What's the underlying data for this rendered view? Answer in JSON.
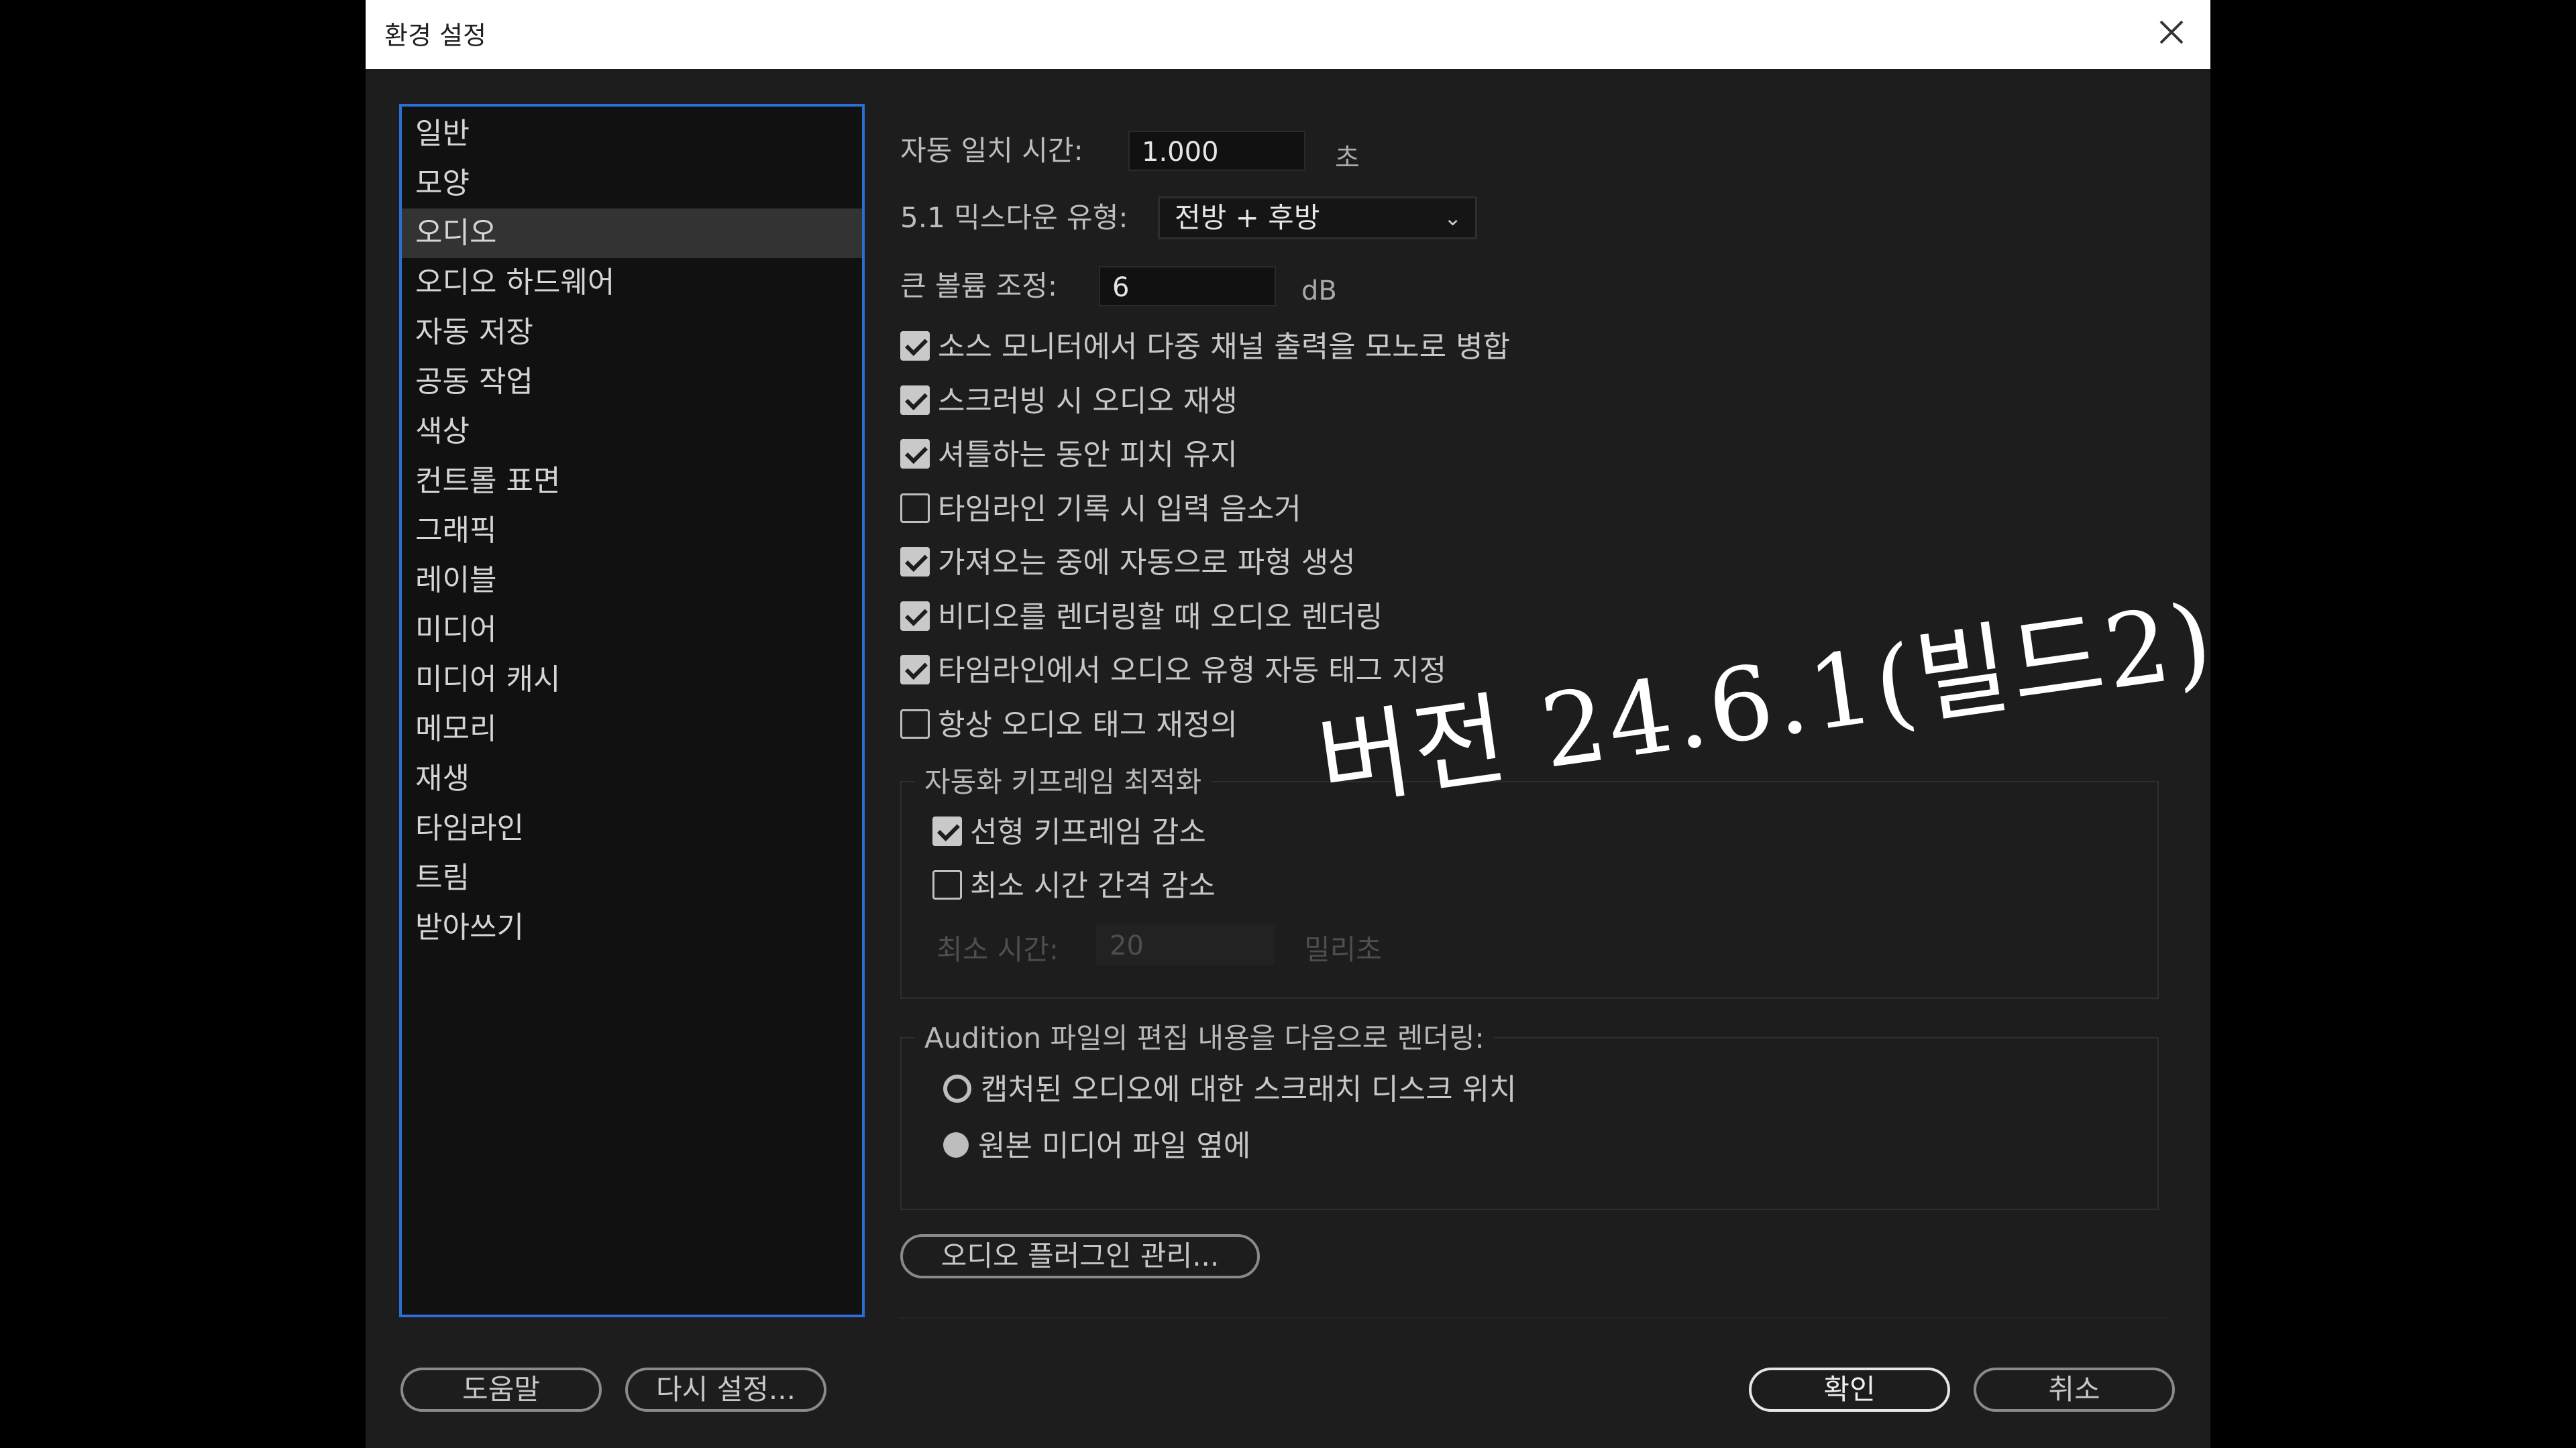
{
  "window": {
    "title": "환경 설정"
  },
  "sidebar": {
    "items": [
      {
        "label": "일반"
      },
      {
        "label": "모양"
      },
      {
        "label": "오디오",
        "selected": true
      },
      {
        "label": "오디오 하드웨어"
      },
      {
        "label": "자동 저장"
      },
      {
        "label": "공동 작업"
      },
      {
        "label": "색상"
      },
      {
        "label": "컨트롤 표면"
      },
      {
        "label": "그래픽"
      },
      {
        "label": "레이블"
      },
      {
        "label": "미디어"
      },
      {
        "label": "미디어 캐시"
      },
      {
        "label": "메모리"
      },
      {
        "label": "재생"
      },
      {
        "label": "타임라인"
      },
      {
        "label": "트림"
      },
      {
        "label": "받아쓰기"
      }
    ]
  },
  "audio": {
    "auto_match": {
      "label": "자동 일치 시간:",
      "value": "1.000",
      "unit": "초"
    },
    "downmix": {
      "label": "5.1 믹스다운 유형:",
      "value": "전방 + 후방"
    },
    "large_volume": {
      "label": "큰 볼륨 조정:",
      "value": "6",
      "unit": "dB"
    },
    "checkboxes": [
      {
        "label": "소스 모니터에서 다중 채널 출력을 모노로 병합",
        "checked": true
      },
      {
        "label": "스크러빙 시 오디오 재생",
        "checked": true
      },
      {
        "label": "셔틀하는 동안 피치 유지",
        "checked": true
      },
      {
        "label": "타임라인 기록 시 입력 음소거",
        "checked": false
      },
      {
        "label": "가져오는 중에 자동으로 파형 생성",
        "checked": true
      },
      {
        "label": "비디오를 렌더링할 때 오디오 렌더링",
        "checked": true
      },
      {
        "label": "타임라인에서 오디오 유형 자동 태그 지정",
        "checked": true
      },
      {
        "label": "항상 오디오 태그 재정의",
        "checked": false
      }
    ],
    "keyframe_group": {
      "title": "자동화 키프레임 최적화",
      "linear": {
        "label": "선형 키프레임 감소",
        "checked": true
      },
      "min_interval": {
        "label": "최소 시간 간격 감소",
        "checked": false
      },
      "min_time": {
        "label": "최소 시간:",
        "value": "20",
        "unit": "밀리초"
      }
    },
    "audition_group": {
      "title": "Audition 파일의 편집 내용을 다음으로 렌더링:",
      "options": [
        {
          "label": "캡처된 오디오에 대한 스크래치 디스크 위치",
          "selected": false
        },
        {
          "label": "원본 미디어 파일 옆에",
          "selected": true
        }
      ]
    },
    "plugin_button": "오디오 플러그인 관리..."
  },
  "footer": {
    "help": "도움말",
    "reset": "다시 설정...",
    "ok": "확인",
    "cancel": "취소"
  },
  "overlay_text": "버전 24.6.1(빌드2)"
}
